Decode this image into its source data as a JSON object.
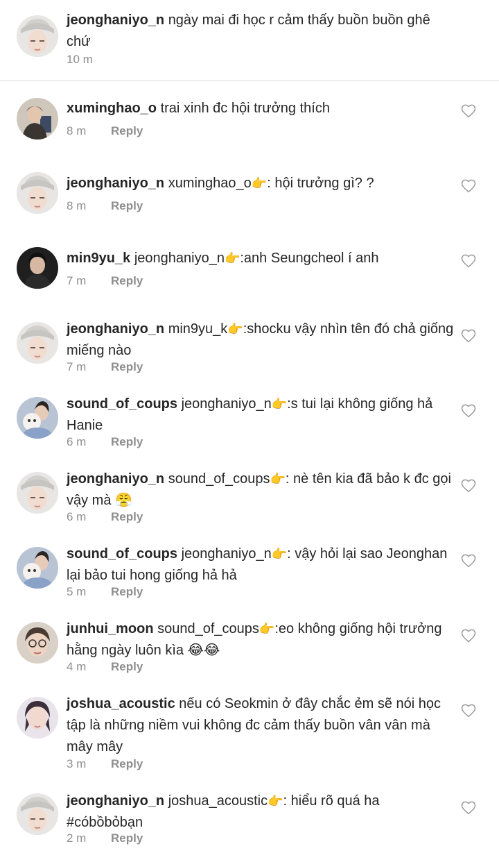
{
  "caption": {
    "username": "jeonghaniyo_n",
    "text": "ngày mai đi học r cảm thấy buồn buồn ghê chứ",
    "time": "10 m"
  },
  "reply_label": "Reply",
  "comments": [
    {
      "username": "xuminghao_o",
      "mention": "",
      "emoji": "",
      "text": "trai xinh đc hội trưởng thích",
      "time": "8 m",
      "avatar": "xuminghao"
    },
    {
      "username": "jeonghaniyo_n",
      "mention": "xuminghao_o",
      "emoji": "👉",
      "text": ": hội trưởng gì? ?",
      "time": "8 m",
      "avatar": "jeonghan"
    },
    {
      "username": "min9yu_k",
      "mention": "jeonghaniyo_n",
      "emoji": "👉",
      "text": ":anh Seungcheol í anh",
      "time": "7 m",
      "avatar": "mingyu"
    },
    {
      "username": "jeonghaniyo_n",
      "mention": "min9yu_k",
      "emoji": "👉",
      "text": ":shocku vậy nhìn tên đó chả giống miếng nào",
      "time": "7 m",
      "avatar": "jeonghan"
    },
    {
      "username": "sound_of_coups",
      "mention": "jeonghaniyo_n",
      "emoji": "👉",
      "text": ":s tui lại không giống hả Hanie",
      "time": "6 m",
      "avatar": "scoups"
    },
    {
      "username": "jeonghaniyo_n",
      "mention": "sound_of_coups",
      "emoji": "👉",
      "text": ": nè tên kia đã bảo k đc gọi vậy mà 😤",
      "time": "6 m",
      "avatar": "jeonghan"
    },
    {
      "username": "sound_of_coups",
      "mention": "jeonghaniyo_n",
      "emoji": "👉",
      "text": ": vậy hỏi lại sao Jeonghan lại bảo tui hong giống hả hả",
      "time": "5 m",
      "avatar": "scoups"
    },
    {
      "username": "junhui_moon",
      "mention": "sound_of_coups",
      "emoji": "👉",
      "text": ":eo không giống hội trưởng hằng ngày luôn kìa 😂😂",
      "time": "4 m",
      "avatar": "junhui"
    },
    {
      "username": "joshua_acoustic",
      "mention": "",
      "emoji": "",
      "text": "nếu có Seokmin ở đây chắc ẻm sẽ nói học tập là những niềm vui không đc cảm thấy buồn vân vân mà mây mây",
      "time": "3 m",
      "avatar": "joshua"
    },
    {
      "username": "jeonghaniyo_n",
      "mention": "joshua_acoustic",
      "emoji": "👉",
      "text": ": hiểu rõ quá ha #cóbồbỏbạn",
      "time": "2 m",
      "avatar": "jeonghan"
    }
  ],
  "colors": {
    "text": "#262626",
    "meta": "#8e8e8e",
    "divider": "#dbdbdb"
  }
}
